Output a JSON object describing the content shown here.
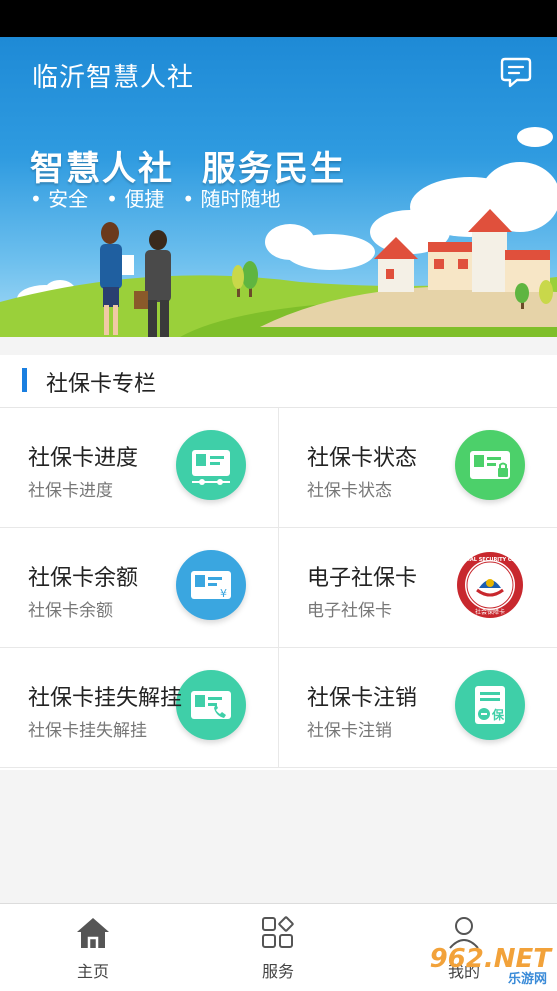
{
  "header": {
    "title": "临沂智慧人社"
  },
  "banner": {
    "slogan": [
      "智慧人社",
      "服务民生"
    ],
    "features": [
      "安全",
      "便捷",
      "随时随地"
    ]
  },
  "section": {
    "title": "社保卡专栏"
  },
  "cards": [
    {
      "title": "社保卡进度",
      "subtitle": "社保卡进度",
      "icon": "card-progress-icon",
      "color": "#3fcfa8"
    },
    {
      "title": "社保卡状态",
      "subtitle": "社保卡状态",
      "icon": "card-status-icon",
      "color": "#4cd06a"
    },
    {
      "title": "社保卡余额",
      "subtitle": "社保卡余额",
      "icon": "card-balance-icon",
      "color": "#3aa6e0"
    },
    {
      "title": "电子社保卡",
      "subtitle": "电子社保卡",
      "icon": "social-security-card-seal-icon",
      "color": "#c8282e"
    },
    {
      "title": "社保卡挂失解挂",
      "subtitle": "社保卡挂失解挂",
      "icon": "card-report-loss-icon",
      "color": "#3fcfa8"
    },
    {
      "title": "社保卡注销",
      "subtitle": "社保卡注销",
      "icon": "card-cancel-icon",
      "color": "#3fcfa8"
    }
  ],
  "seal": {
    "text": "SOCIAL SECURITY CARD",
    "bottom": "社会保障卡"
  },
  "tabs": [
    {
      "label": "主页",
      "icon": "home-icon"
    },
    {
      "label": "服务",
      "icon": "services-grid-icon"
    },
    {
      "label": "我的",
      "icon": "user-icon"
    }
  ],
  "watermark": {
    "main": "962.NET",
    "sub": "乐游网"
  }
}
